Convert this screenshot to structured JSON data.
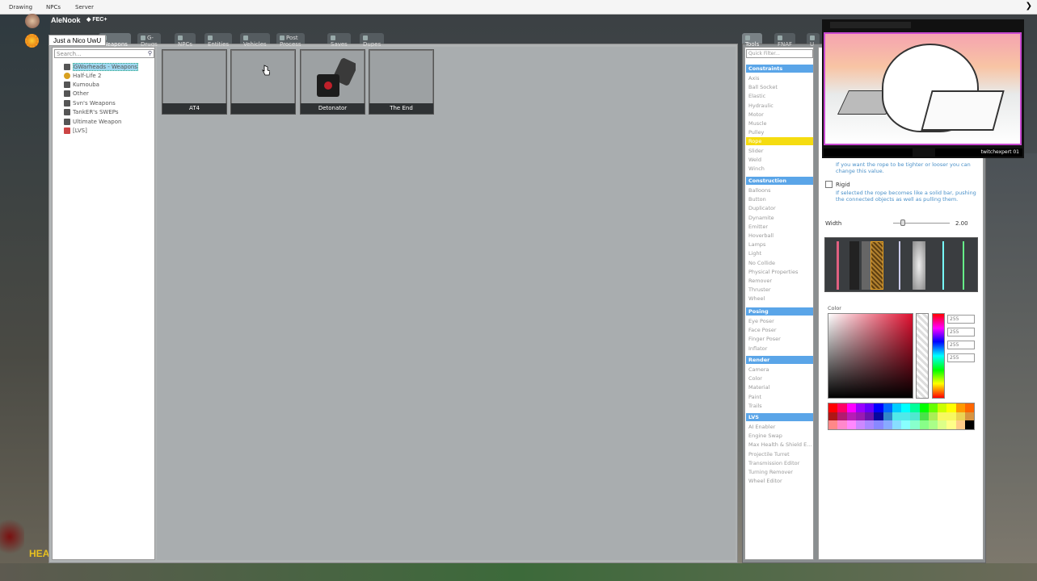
{
  "menubar": {
    "items": [
      "Drawing",
      "NPCs",
      "Server"
    ]
  },
  "player": {
    "name": "AleNook",
    "badge": "◆ FEC+",
    "tooltip": "Just a Nico UwU"
  },
  "spawn_tabs": [
    "Weapons",
    "G-Drugs",
    "NPCs",
    "Entities",
    "Vehicles",
    "Post Process",
    "Saves",
    "Dupes"
  ],
  "tree": {
    "search_placeholder": "Search...",
    "items": [
      "GWarheads - Weapons",
      "Half-Life 2",
      "Kumouba",
      "Other",
      "Svn's Weapons",
      "TankER's SWEPs",
      "Ultimate Weapon",
      "[LVS]"
    ]
  },
  "icons": [
    "AT4",
    "",
    "Detonator",
    "The End"
  ],
  "tool_tabs": [
    "Tools",
    "FNAF",
    "U"
  ],
  "tools": {
    "filter_placeholder": "Quick Filter...",
    "constraints_title": "Constraints",
    "constraints": [
      "Axis",
      "Ball Socket",
      "Elastic",
      "Hydraulic",
      "Motor",
      "Muscle",
      "Pulley",
      "Rope",
      "Slider",
      "Weld",
      "Winch"
    ],
    "construction_title": "Construction",
    "construction": [
      "Balloons",
      "Button",
      "Duplicator",
      "Dynamite",
      "Emitter",
      "Hoverball",
      "Lamps",
      "Light",
      "No Collide",
      "Physical Properties",
      "Remover",
      "Thruster",
      "Wheel"
    ],
    "posing_title": "Posing",
    "posing": [
      "Eye Poser",
      "Face Poser",
      "Finger Poser",
      "Inflator"
    ],
    "render_title": "Render",
    "render": [
      "Camera",
      "Color",
      "Material",
      "Paint",
      "Trails"
    ],
    "lvs_title": "LVS",
    "lvs": [
      "AI Enabler",
      "Engine Swap",
      "Max Health & Shield E...",
      "Projectile Turret",
      "Transmission Editor",
      "Turning Remover",
      "Wheel Editor"
    ],
    "selected": "Rope"
  },
  "rope_panel": {
    "help1": "If you want the rope to be tighter or looser you can change this value.",
    "rigid_label": "Rigid",
    "help2": "If selected the rope becomes like a solid bar, pushing the connected objects as well as pulling them.",
    "width_label": "Width",
    "width_value": "2.00",
    "width_fraction": 0.05,
    "color_label": "Color",
    "rgba": [
      "255",
      "255",
      "255",
      "255"
    ]
  },
  "overlay": {
    "caption": "twitchexpert 01"
  },
  "hud": {
    "health_label": "HEA"
  }
}
